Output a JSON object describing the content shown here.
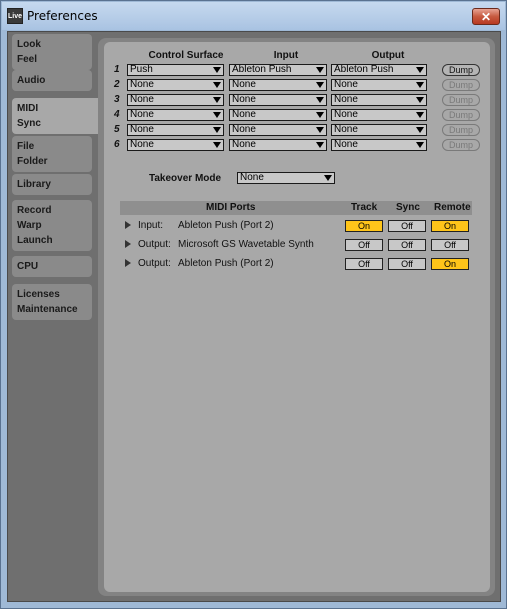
{
  "window": {
    "title": "Preferences",
    "icon_text": "Live",
    "close_symbol": "✕"
  },
  "sidebar": {
    "tabs": [
      {
        "lines": [
          "Look",
          "Feel"
        ],
        "active": false
      },
      {
        "lines": [
          "Audio"
        ],
        "active": false
      },
      {
        "lines": [
          "MIDI",
          "Sync"
        ],
        "active": true
      },
      {
        "lines": [
          "File",
          "Folder"
        ],
        "active": false
      },
      {
        "lines": [
          "Library"
        ],
        "active": false
      },
      {
        "lines": [
          "Record",
          "Warp",
          "Launch"
        ],
        "active": false
      },
      {
        "lines": [
          "CPU"
        ],
        "active": false
      },
      {
        "lines": [
          "Licenses",
          "Maintenance"
        ],
        "active": false
      }
    ]
  },
  "control_surfaces": {
    "headers": {
      "surface": "Control Surface",
      "input": "Input",
      "output": "Output"
    },
    "dump_label": "Dump",
    "rows": [
      {
        "num": "1",
        "surface": "Push",
        "input": "Ableton Push",
        "output": "Ableton Push",
        "dump_enabled": true
      },
      {
        "num": "2",
        "surface": "None",
        "input": "None",
        "output": "None",
        "dump_enabled": false
      },
      {
        "num": "3",
        "surface": "None",
        "input": "None",
        "output": "None",
        "dump_enabled": false
      },
      {
        "num": "4",
        "surface": "None",
        "input": "None",
        "output": "None",
        "dump_enabled": false
      },
      {
        "num": "5",
        "surface": "None",
        "input": "None",
        "output": "None",
        "dump_enabled": false
      },
      {
        "num": "6",
        "surface": "None",
        "input": "None",
        "output": "None",
        "dump_enabled": false
      }
    ]
  },
  "takeover": {
    "label": "Takeover Mode",
    "value": "None"
  },
  "midi_ports": {
    "headers": {
      "ports": "MIDI Ports",
      "track": "Track",
      "sync": "Sync",
      "remote": "Remote"
    },
    "rows": [
      {
        "type": "Input:",
        "name": "Ableton Push (Port 2)",
        "track": "On",
        "sync": "Off",
        "remote": "On"
      },
      {
        "type": "Output:",
        "name": "Microsoft GS Wavetable Synth",
        "track": "Off",
        "sync": "Off",
        "remote": "Off"
      },
      {
        "type": "Output:",
        "name": "Ableton Push (Port 2)",
        "track": "Off",
        "sync": "Off",
        "remote": "On"
      }
    ]
  },
  "colors": {
    "toggle_on": "#ffc51a",
    "panel": "#a8a8a8",
    "background": "#6f6f6f"
  }
}
